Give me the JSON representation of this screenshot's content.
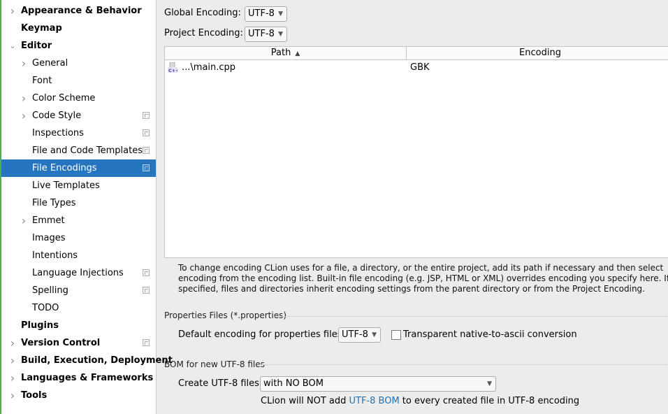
{
  "sidebar": {
    "items": [
      {
        "label": "Appearance & Behavior",
        "level": 0,
        "bold": true,
        "chevron": "right",
        "copy": false,
        "selected": false
      },
      {
        "label": "Keymap",
        "level": 0,
        "bold": true,
        "chevron": "",
        "copy": false,
        "selected": false
      },
      {
        "label": "Editor",
        "level": 0,
        "bold": true,
        "chevron": "down",
        "copy": false,
        "selected": false
      },
      {
        "label": "General",
        "level": 1,
        "bold": false,
        "chevron": "right",
        "copy": false,
        "selected": false
      },
      {
        "label": "Font",
        "level": 1,
        "bold": false,
        "chevron": "",
        "copy": false,
        "selected": false
      },
      {
        "label": "Color Scheme",
        "level": 1,
        "bold": false,
        "chevron": "right",
        "copy": false,
        "selected": false
      },
      {
        "label": "Code Style",
        "level": 1,
        "bold": false,
        "chevron": "right",
        "copy": true,
        "selected": false
      },
      {
        "label": "Inspections",
        "level": 1,
        "bold": false,
        "chevron": "",
        "copy": true,
        "selected": false
      },
      {
        "label": "File and Code Templates",
        "level": 1,
        "bold": false,
        "chevron": "",
        "copy": true,
        "selected": false
      },
      {
        "label": "File Encodings",
        "level": 1,
        "bold": false,
        "chevron": "",
        "copy": true,
        "selected": true
      },
      {
        "label": "Live Templates",
        "level": 1,
        "bold": false,
        "chevron": "",
        "copy": false,
        "selected": false
      },
      {
        "label": "File Types",
        "level": 1,
        "bold": false,
        "chevron": "",
        "copy": false,
        "selected": false
      },
      {
        "label": "Emmet",
        "level": 1,
        "bold": false,
        "chevron": "right",
        "copy": false,
        "selected": false
      },
      {
        "label": "Images",
        "level": 1,
        "bold": false,
        "chevron": "",
        "copy": false,
        "selected": false
      },
      {
        "label": "Intentions",
        "level": 1,
        "bold": false,
        "chevron": "",
        "copy": false,
        "selected": false
      },
      {
        "label": "Language Injections",
        "level": 1,
        "bold": false,
        "chevron": "",
        "copy": true,
        "selected": false
      },
      {
        "label": "Spelling",
        "level": 1,
        "bold": false,
        "chevron": "",
        "copy": true,
        "selected": false
      },
      {
        "label": "TODO",
        "level": 1,
        "bold": false,
        "chevron": "",
        "copy": false,
        "selected": false
      },
      {
        "label": "Plugins",
        "level": 0,
        "bold": true,
        "chevron": "",
        "copy": false,
        "selected": false
      },
      {
        "label": "Version Control",
        "level": 0,
        "bold": true,
        "chevron": "right",
        "copy": true,
        "selected": false
      },
      {
        "label": "Build, Execution, Deployment",
        "level": 0,
        "bold": true,
        "chevron": "right",
        "copy": false,
        "selected": false
      },
      {
        "label": "Languages & Frameworks",
        "level": 0,
        "bold": true,
        "chevron": "right",
        "copy": false,
        "selected": false
      },
      {
        "label": "Tools",
        "level": 0,
        "bold": true,
        "chevron": "right",
        "copy": false,
        "selected": false
      }
    ]
  },
  "main": {
    "global_encoding_label": "Global Encoding:",
    "global_encoding_value": "UTF-8",
    "project_encoding_label": "Project Encoding:",
    "project_encoding_value": "UTF-8",
    "table": {
      "col_path": "Path",
      "col_encoding": "Encoding",
      "rows": [
        {
          "path": "...\\main.cpp",
          "encoding": "GBK"
        }
      ]
    },
    "help_text": "To change encoding CLion uses for a file, a directory, or the entire project, add its path if necessary and then select encoding from the encoding list. Built-in file encoding (e.g. JSP, HTML or XML) overrides encoding you specify here. If not specified, files and directories inherit encoding settings from the parent directory or from the Project Encoding.",
    "properties_section_title": "Properties Files (*.properties)",
    "default_properties_label": "Default encoding for properties files:",
    "default_properties_value": "UTF-8",
    "transparent_label": "Transparent native-to-ascii conversion",
    "transparent_checked": false,
    "bom_section_title": "BOM for new UTF-8 files",
    "create_utf8_label": "Create UTF-8 files:",
    "create_utf8_value": "with NO BOM",
    "bom_note_prefix": "CLion will NOT add ",
    "bom_note_link": "UTF-8 BOM",
    "bom_note_suffix": " to every created file in UTF-8 encoding"
  },
  "colors": {
    "selection": "#2675bf",
    "link": "#2470b3",
    "sidebar_accent": "#4caf50"
  }
}
